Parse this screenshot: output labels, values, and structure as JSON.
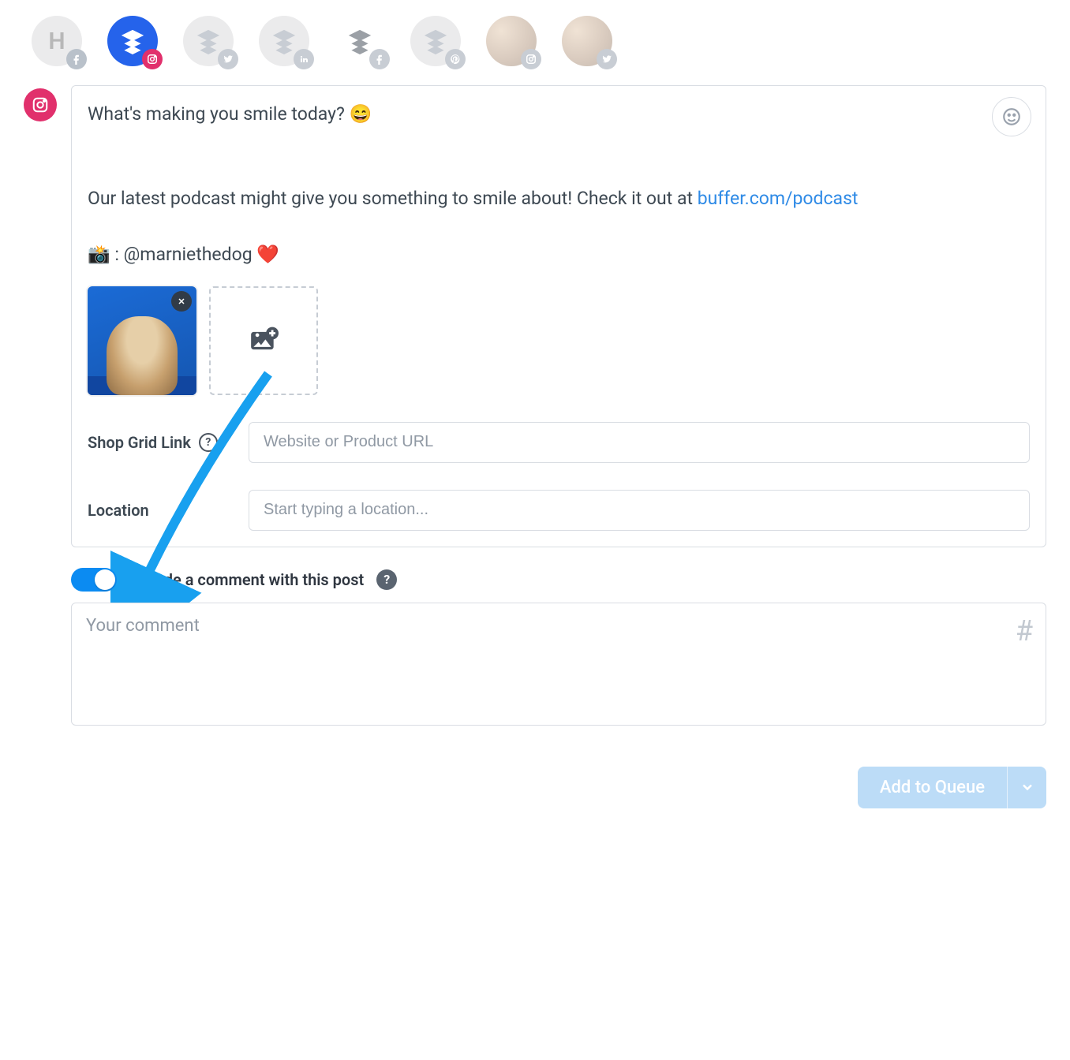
{
  "accounts": [
    {
      "type": "letter",
      "letter": "H",
      "circle_bg": "#ebebec",
      "badge_bg": "#b9c1ca",
      "badge_icon": "facebook"
    },
    {
      "type": "buffer",
      "circle_bg": "#2563eb",
      "layers": "#ffffff",
      "badge_bg": "#e1306c",
      "badge_icon": "instagram",
      "active": true
    },
    {
      "type": "buffer",
      "circle_bg": "#ebebec",
      "layers": "#c8cdd4",
      "badge_bg": "#c8cdd4",
      "badge_icon": "twitter"
    },
    {
      "type": "buffer",
      "circle_bg": "#ebebec",
      "layers": "#c8cdd4",
      "badge_bg": "#c8cdd4",
      "badge_icon": "linkedin"
    },
    {
      "type": "buffer",
      "circle_bg": "#ffffff",
      "layers": "#4a535e",
      "badge_bg": "#c8cdd4",
      "badge_icon": "facebook"
    },
    {
      "type": "buffer",
      "circle_bg": "#ebebec",
      "layers": "#c8cdd4",
      "badge_bg": "#c8cdd4",
      "badge_icon": "pinterest"
    },
    {
      "type": "avatar",
      "badge_bg": "#c8cdd4",
      "badge_icon": "instagram"
    },
    {
      "type": "avatar",
      "badge_bg": "#c8cdd4",
      "badge_icon": "twitter"
    }
  ],
  "composer": {
    "line1": "What's making you smile today? 😄",
    "line2": "Our latest podcast might give you something to smile about! Check it out at ",
    "link": "buffer.com/podcast",
    "credit_prefix": "📸 : @marniethedog  ",
    "credit_emoji": "❤️"
  },
  "fields": {
    "shopgrid_label": "Shop Grid Link",
    "shopgrid_placeholder": "Website or Product URL",
    "location_label": "Location",
    "location_placeholder": "Start typing a location..."
  },
  "toggle": {
    "label": "Include a comment with this post",
    "on": true
  },
  "comment": {
    "placeholder": "Your comment"
  },
  "footer": {
    "queue_label": "Add to Queue"
  }
}
